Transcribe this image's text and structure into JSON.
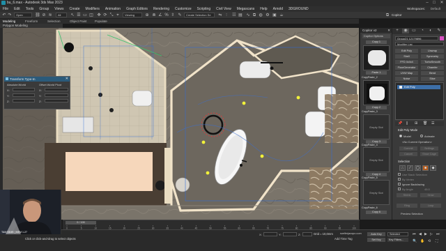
{
  "window": {
    "title": "bu_6.max - Autodesk 3ds Max 2023",
    "controls": [
      "–",
      "□",
      "✕"
    ]
  },
  "menu": {
    "items": [
      "File",
      "Edit",
      "Tools",
      "Group",
      "Views",
      "Create",
      "Modifiers",
      "Animation",
      "Graph Editors",
      "Rendering",
      "Customize",
      "Scripting",
      "Civil View",
      "Megascans",
      "Help",
      "Arnold",
      "3DGROUND"
    ],
    "workspaces_label": "Workspaces:",
    "workspaces_value": "Default",
    "copitor": "Copitor"
  },
  "toolbar": {
    "layer_dropdown": "Open",
    "filter_dropdown": "All",
    "view_dropdown": "Viewing",
    "selection_set": "Create Selection Se",
    "icons": [
      "undo-icon",
      "redo-icon",
      "link-icon",
      "unlink-icon",
      "bind-icon",
      "select-icon",
      "select-region-icon",
      "move-icon",
      "rotate-icon",
      "scale-icon",
      "snap-icon",
      "mirror-icon",
      "align-icon",
      "render-icon"
    ]
  },
  "ribbon": {
    "tabs": [
      "Modeling",
      "Freeform",
      "Selection",
      "Object Paint",
      "Populate"
    ],
    "sub": "Polygon Modeling"
  },
  "transform_typein": {
    "title": "Transform Type-In",
    "col_left": "Absolute:World",
    "col_right": "Offset:World Pivot",
    "axes": [
      "X:",
      "Y:",
      "Z:"
    ]
  },
  "copitor": {
    "title": "Copitor v2",
    "options": "Copitor Options",
    "slots": [
      {
        "label": "Copy 1",
        "btn": "Paste 1",
        "kind": "thumb"
      },
      {
        "label": "CopyPaste_2",
        "btn": "Copy 2",
        "kind": "thumb"
      },
      {
        "label": "CopyPaste_3",
        "btn": "Copy 3",
        "kind": "empty"
      },
      {
        "label": "CopyPaste_4",
        "btn": "Copy 4",
        "kind": "empty"
      },
      {
        "label": "CopyPaste_5",
        "btn": "Copy 5",
        "kind": "empty"
      },
      {
        "label": "CopyPaste_6",
        "btn": "Copy 6",
        "kind": "empty"
      }
    ],
    "empty_text": "Empty Slot"
  },
  "command_panel": {
    "tabs": [
      "+",
      "◉",
      "▭",
      "◔",
      "◐",
      "✎"
    ],
    "object_name": "Group21 12179896",
    "object_color": "#d84fc2",
    "modifier_list": "Modifier List",
    "mod_buttons": [
      "Edit Poly",
      "Unwrap",
      "Shell",
      "Symmetry",
      "FFD 4x4x4",
      "TurboSmooth",
      "FloorGenerator",
      "Chamfer",
      "UVW Map",
      "Bend",
      "Noise",
      "Slice"
    ],
    "stack_item": "Edit Poly",
    "edit_poly_mode": {
      "header": "Edit Poly Mode",
      "model": "Model",
      "animate": "Animate",
      "current_op": "<No Current Operation>",
      "commit": "Commit",
      "settings": "Settings",
      "cancel": "Cancel",
      "show_cage": "Show Cage"
    },
    "selection": {
      "header": "Selection",
      "use_stack": "Use Stack Selection",
      "by_vertex": "By Vertex",
      "ignore_backfacing": "Ignore Backfacing",
      "by_angle": "By Angle",
      "angle_value": "45.0",
      "shrink": "Shrink",
      "grow": "Grow",
      "ring": "Ring",
      "loop": "Loop",
      "preview": "Preview Selection",
      "icons": [
        "vertex-icon",
        "edge-icon",
        "border-icon",
        "polygon-icon",
        "element-icon"
      ]
    }
  },
  "timeline": {
    "slider": "0 / 100",
    "ticks": [
      "0",
      "5",
      "10",
      "15",
      "20",
      "25",
      "30",
      "35",
      "40",
      "45",
      "50",
      "55",
      "60",
      "65",
      "70",
      "75",
      "80",
      "85",
      "90",
      "95",
      "100"
    ]
  },
  "status": {
    "message": "Click or click-and-drag to select objects",
    "x": "X:",
    "y": "Y:",
    "z": "Z:",
    "grid": "Grid = 10,0mm",
    "add_time_tag": "Add Time Tag",
    "web": "soellerjacopo.com",
    "auto_key": "Auto Key",
    "set_key": "Set Key",
    "selected": "Selected",
    "key_filters": "Key Filters..."
  },
  "webcam": {
    "caption": "TAM 94MB | MEM 1.27"
  },
  "colors": {
    "floor_gray": "#7d776d",
    "tile_cream": "#d6cdb7",
    "wall_cream": "#efe1c7",
    "selection_blue": "#2f6bd8",
    "highlight_yellow": "#f2f23a",
    "rug_peach": "#f6d7bb"
  }
}
